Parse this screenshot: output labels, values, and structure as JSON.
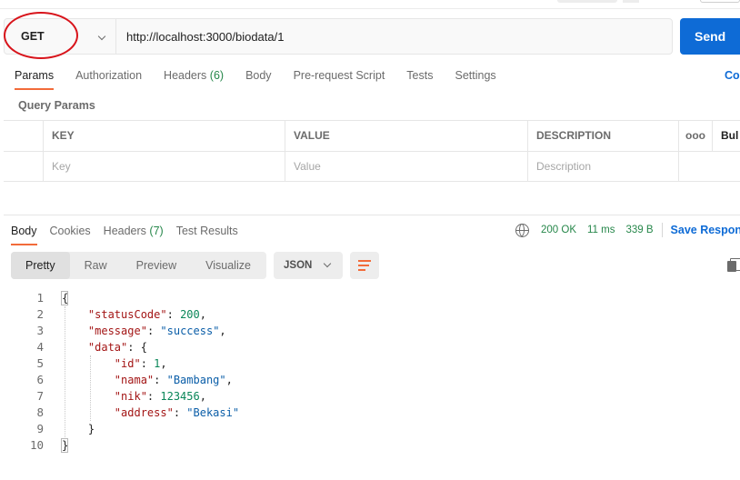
{
  "request": {
    "method": "GET",
    "url": "http://localhost:3000/biodata/1",
    "send_label": "Send"
  },
  "request_tabs": [
    {
      "label": "Params",
      "count": ""
    },
    {
      "label": "Authorization",
      "count": ""
    },
    {
      "label": "Headers",
      "count": "(6)"
    },
    {
      "label": "Body",
      "count": ""
    },
    {
      "label": "Pre-request Script",
      "count": ""
    },
    {
      "label": "Tests",
      "count": ""
    },
    {
      "label": "Settings",
      "count": ""
    }
  ],
  "cookies_link": "Co",
  "query_params": {
    "title": "Query Params",
    "headers": {
      "key": "KEY",
      "value": "VALUE",
      "description": "DESCRIPTION",
      "more": "ooo",
      "bulk": "Bul"
    },
    "placeholders": {
      "key": "Key",
      "value": "Value",
      "description": "Description"
    }
  },
  "response_tabs": [
    {
      "label": "Body",
      "count": ""
    },
    {
      "label": "Cookies",
      "count": ""
    },
    {
      "label": "Headers",
      "count": "(7)"
    },
    {
      "label": "Test Results",
      "count": ""
    }
  ],
  "response_status": {
    "status": "200 OK",
    "time": "11 ms",
    "size": "339 B",
    "save_label": "Save Respons"
  },
  "view_modes": [
    "Pretty",
    "Raw",
    "Preview",
    "Visualize"
  ],
  "format": "JSON",
  "code_lines": [
    {
      "n": "1",
      "text": "{"
    },
    {
      "n": "2",
      "text": "    \"statusCode\": 200,"
    },
    {
      "n": "3",
      "text": "    \"message\": \"success\","
    },
    {
      "n": "4",
      "text": "    \"data\": {"
    },
    {
      "n": "5",
      "text": "        \"id\": 1,"
    },
    {
      "n": "6",
      "text": "        \"nama\": \"Bambang\","
    },
    {
      "n": "7",
      "text": "        \"nik\": 123456,"
    },
    {
      "n": "8",
      "text": "        \"address\": \"Bekasi\""
    },
    {
      "n": "9",
      "text": "    }"
    },
    {
      "n": "10",
      "text": "}"
    }
  ],
  "colors": {
    "accent_tab": "#f26b3a",
    "send_button": "#0e6bd6",
    "status_green": "#26874a",
    "annotation_ellipse": "#d8141b"
  }
}
